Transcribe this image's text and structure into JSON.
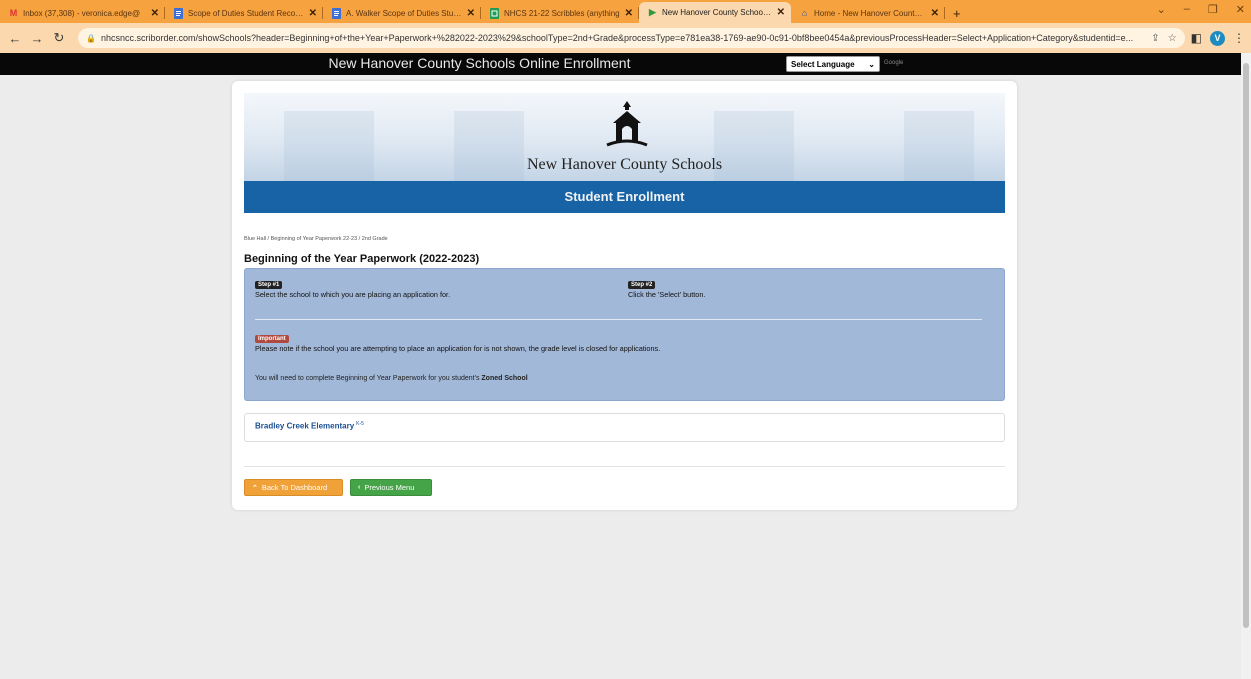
{
  "browser": {
    "tabs": [
      {
        "title": "Inbox (37,308) - veronica.edge@",
        "icon": "gmail-icon",
        "active": false
      },
      {
        "title": "Scope of Duties Student Records",
        "icon": "docs-icon",
        "active": false
      },
      {
        "title": "A. Walker Scope of Duties Studen",
        "icon": "docs-icon",
        "active": false
      },
      {
        "title": "NHCS 21-22 Scribbles (anything",
        "icon": "sheets-icon",
        "active": false
      },
      {
        "title": "New Hanover County Schools O",
        "icon": "play-icon",
        "active": true
      },
      {
        "title": "Home - New Hanover County Sc",
        "icon": "school-icon",
        "active": false
      }
    ],
    "new_tab": "+",
    "url": "nhcsncc.scriborder.com/showSchools?header=Beginning+of+the+Year+Paperwork+%282022-2023%29&schoolType=2nd+Grade&processType=e781ea38-1769-ae90-0c91-0bf8bee0454a&previousProcessHeader=Select+Application+Category&studentid=e...",
    "profile_initial": "V",
    "colors": {
      "tabstrip": "#f6a23f",
      "toolbar": "#fbd8ad"
    }
  },
  "site": {
    "title": "New Hanover County Schools Online Enrollment",
    "language_select": "Select Language",
    "google_label": "Google"
  },
  "banner": {
    "org_name": "New Hanover County Schools",
    "subtitle": "Student Enrollment",
    "color": "#1763a6"
  },
  "breadcrumb": "Blue Hall / Beginning of Year Paperwork 22-23 / 2nd Grade",
  "page_title": "Beginning of the Year Paperwork (2022-2023)",
  "instructions": {
    "step1": {
      "badge": "Step #1",
      "text": "Select the school to which you are placing an application for."
    },
    "step2": {
      "badge": "Step #2",
      "text": "Click the 'Select' button."
    },
    "important": {
      "badge": "Important",
      "text": "Please note if the school you are attempting to place an application for is not shown, the grade level is closed for applications."
    },
    "zoned_prefix": "You will need to complete Beginning of Year Paperwork for you student's ",
    "zoned_bold": "Zoned School"
  },
  "schools": [
    {
      "name": "Bradley Creek Elementary",
      "grades": "K-5"
    }
  ],
  "buttons": {
    "back": "Back To Dashboard",
    "previous": "Previous Menu"
  }
}
